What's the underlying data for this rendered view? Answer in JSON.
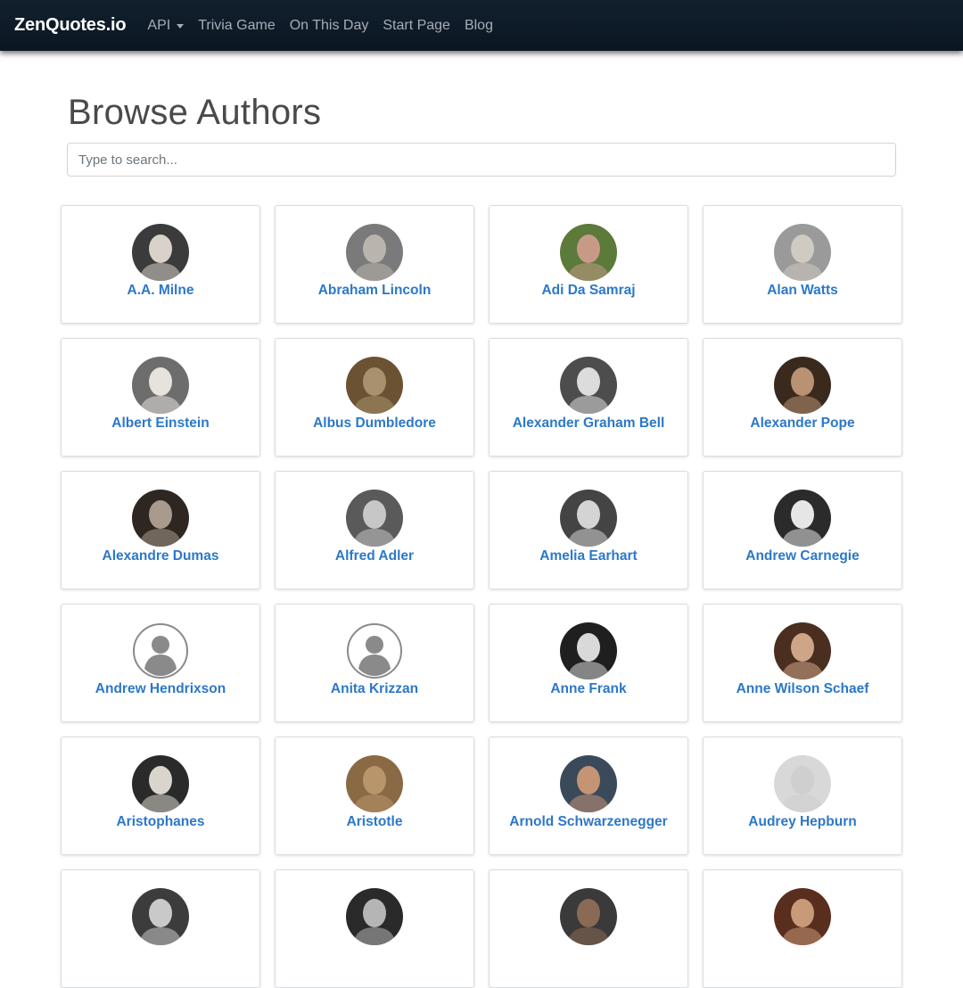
{
  "navbar": {
    "brand": "ZenQuotes.io",
    "links": [
      {
        "label": "API",
        "dropdown": true
      },
      {
        "label": "Trivia Game"
      },
      {
        "label": "On This Day"
      },
      {
        "label": "Start Page"
      },
      {
        "label": "Blog"
      }
    ]
  },
  "page_title": "Browse Authors",
  "search": {
    "placeholder": "Type to search...",
    "value": ""
  },
  "authors": [
    {
      "name": "A.A. Milne",
      "avatar": "photo",
      "tone": "#3b3b3b",
      "skin": "#d8d2ca"
    },
    {
      "name": "Abraham Lincoln",
      "avatar": "photo",
      "tone": "#7a7a7a",
      "skin": "#b9b4ad"
    },
    {
      "name": "Adi Da Samraj",
      "avatar": "photo",
      "tone": "#5c7a3a",
      "skin": "#c79a86"
    },
    {
      "name": "Alan Watts",
      "avatar": "photo",
      "tone": "#9a9a9a",
      "skin": "#cfcac2"
    },
    {
      "name": "Albert Einstein",
      "avatar": "photo",
      "tone": "#6d6d6d",
      "skin": "#e6e2dc"
    },
    {
      "name": "Albus Dumbledore",
      "avatar": "photo",
      "tone": "#6b5232",
      "skin": "#a8916c"
    },
    {
      "name": "Alexander Graham Bell",
      "avatar": "photo",
      "tone": "#4d4d4d",
      "skin": "#dcdcdc"
    },
    {
      "name": "Alexander Pope",
      "avatar": "photo",
      "tone": "#3a2a1e",
      "skin": "#b89272"
    },
    {
      "name": "Alexandre Dumas",
      "avatar": "photo",
      "tone": "#2e2621",
      "skin": "#a89a8c"
    },
    {
      "name": "Alfred Adler",
      "avatar": "photo",
      "tone": "#5a5a5a",
      "skin": "#c7c7c7"
    },
    {
      "name": "Amelia Earhart",
      "avatar": "photo",
      "tone": "#444444",
      "skin": "#d4d4d4"
    },
    {
      "name": "Andrew Carnegie",
      "avatar": "photo",
      "tone": "#2b2b2b",
      "skin": "#e6e6e6"
    },
    {
      "name": "Andrew Hendrixson",
      "avatar": "placeholder",
      "tone": "#8a8a8a",
      "skin": "#8a8a8a"
    },
    {
      "name": "Anita Krizzan",
      "avatar": "placeholder",
      "tone": "#8a8a8a",
      "skin": "#8a8a8a"
    },
    {
      "name": "Anne Frank",
      "avatar": "photo",
      "tone": "#1f1f1f",
      "skin": "#d9d9d9"
    },
    {
      "name": "Anne Wilson Schaef",
      "avatar": "photo",
      "tone": "#4a2f20",
      "skin": "#cfa588"
    },
    {
      "name": "Aristophanes",
      "avatar": "photo",
      "tone": "#2a2a2a",
      "skin": "#d9d5cc"
    },
    {
      "name": "Aristotle",
      "avatar": "photo",
      "tone": "#8a6a45",
      "skin": "#b8956b"
    },
    {
      "name": "Arnold Schwarzenegger",
      "avatar": "photo",
      "tone": "#3a4a5a",
      "skin": "#c49474"
    },
    {
      "name": "Audrey Hepburn",
      "avatar": "photo",
      "tone": "#d8d8d8",
      "skin": "#cfcfcf"
    },
    {
      "name": "",
      "avatar": "photo",
      "tone": "#3c3c3c",
      "skin": "#c9c9c9"
    },
    {
      "name": "",
      "avatar": "photo",
      "tone": "#2a2a2a",
      "skin": "#b5b5b5"
    },
    {
      "name": "",
      "avatar": "photo",
      "tone": "#3a3a3a",
      "skin": "#8a6a55"
    },
    {
      "name": "",
      "avatar": "photo",
      "tone": "#5a2e1e",
      "skin": "#c99a78"
    }
  ],
  "colors": {
    "navbar": "#0f1b27",
    "link": "#2c78c8",
    "title": "#4a4a4a"
  }
}
